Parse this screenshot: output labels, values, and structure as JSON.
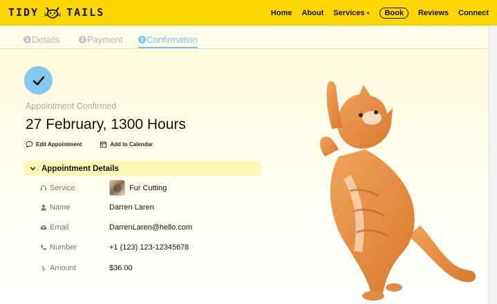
{
  "brand": {
    "name_left": "TIDY",
    "name_right": "TAILS",
    "logo_icon": "cat-face-icon",
    "color": "#ffd600"
  },
  "nav": {
    "items": [
      {
        "label": "Home"
      },
      {
        "label": "About"
      },
      {
        "label": "Services"
      },
      {
        "label": "Book"
      },
      {
        "label": "Reviews"
      },
      {
        "label": "Connect"
      }
    ],
    "services_caret": "▲"
  },
  "steps": {
    "items": [
      {
        "num": "1",
        "label": "Details",
        "state": "done"
      },
      {
        "num": "2",
        "label": "Payment",
        "state": "done"
      },
      {
        "num": "3",
        "label": "Confirmation",
        "state": "active"
      }
    ],
    "active_color": "#6ec6ee"
  },
  "confirmation": {
    "status_label": "Appointment Confirmed",
    "datetime": "27 February, 1300 Hours",
    "actions": {
      "edit_label": "Edit Appointment",
      "calendar_label": "Add to Calendar"
    }
  },
  "details": {
    "section_title": "Appointment Details",
    "rows": [
      {
        "label": "Service",
        "value": "Fur Cutting",
        "icon": "headset-icon"
      },
      {
        "label": "Name",
        "value": "Darren Laren",
        "icon": "person-icon"
      },
      {
        "label": "Email",
        "value": "DarrenLaren@hello.com",
        "icon": "envelope-icon"
      },
      {
        "label": "Number",
        "value": "+1 (123) 123-12345678",
        "icon": "phone-icon"
      },
      {
        "label": "Amount",
        "value": "$36.00",
        "icon": "dollar-icon"
      }
    ]
  }
}
